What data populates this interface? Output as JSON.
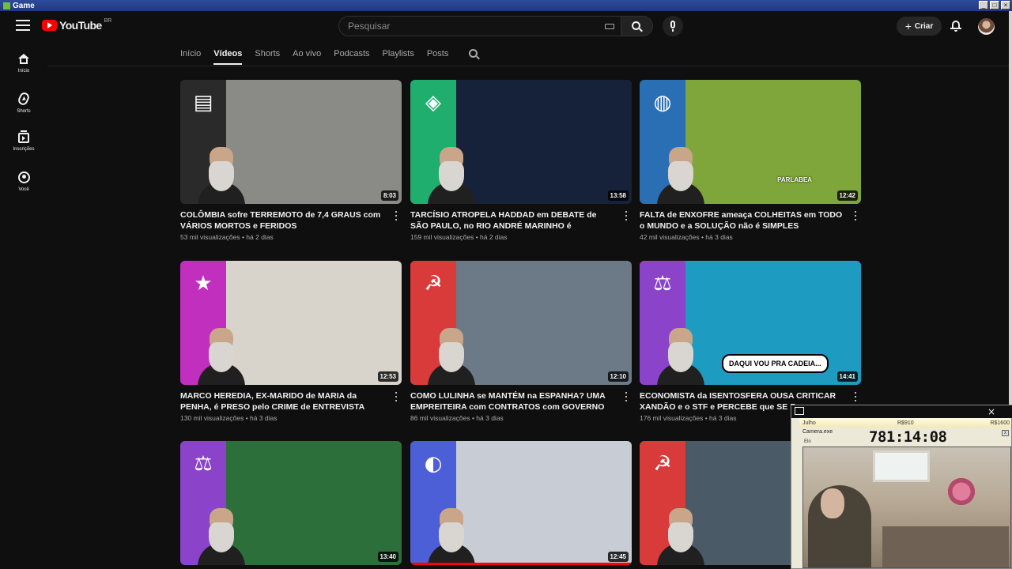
{
  "window": {
    "title": "Game",
    "buttons": [
      "_",
      "□",
      "×"
    ]
  },
  "header": {
    "logo_text": "YouTube",
    "logo_country": "BR",
    "search_placeholder": "Pesquisar",
    "create_label": "Criar",
    "create_icon": "+"
  },
  "sidebar": {
    "items": [
      {
        "label": "Início",
        "icon": "home-icon"
      },
      {
        "label": "Shorts",
        "icon": "shorts-icon"
      },
      {
        "label": "Inscrições",
        "icon": "subscriptions-icon"
      },
      {
        "label": "Você",
        "icon": "you-icon"
      }
    ]
  },
  "tabs": [
    {
      "label": "Início",
      "active": false
    },
    {
      "label": "Vídeos",
      "active": true
    },
    {
      "label": "Shorts",
      "active": false
    },
    {
      "label": "Ao vivo",
      "active": false
    },
    {
      "label": "Podcasts",
      "active": false
    },
    {
      "label": "Playlists",
      "active": false
    },
    {
      "label": "Posts",
      "active": false
    }
  ],
  "videos": [
    {
      "title": "COLÔMBIA sofre TERREMOTO de 7,4 GRAUS com VÁRIOS MORTOS e FERIDOS",
      "views": "53 mil visualizações",
      "age": "há 2 dias",
      "duration": "8:03",
      "band_color": "#2a2a2a",
      "badge": "newspaper-icon",
      "scene": "#8a8a86"
    },
    {
      "title": "TARCÍSIO ATROPELA HADDAD em DEBATE de SÃO PAULO, no RIO ANDRÉ MARINHO é DESTAQUE",
      "views": "159 mil visualizações",
      "age": "há 2 dias",
      "duration": "13:58",
      "band_color": "#1fae6e",
      "badge": "flag-brazil-icon",
      "scene": "#16213a"
    },
    {
      "title": "FALTA de ENXOFRE ameaça COLHEITAS em TODO o MUNDO e a SOLUÇÃO não é SIMPLES",
      "views": "42 mil visualizações",
      "age": "há 3 dias",
      "duration": "12:42",
      "band_color": "#2a6fb3",
      "badge": "globe-icon",
      "scene": "#7ea63a",
      "brand": "PARLABEA"
    },
    {
      "title": "MARCO HEREDIA, EX-MARIDO de MARIA da PENHA, é PRESO pelo CRIME de ENTREVISTA",
      "views": "130 mil visualizações",
      "age": "há 3 dias",
      "duration": "12:53",
      "band_color": "#c12fbf",
      "badge": "star-icon",
      "scene": "#d8d4cc"
    },
    {
      "title": "COMO LULINHA se MANTÉM na ESPANHA? UMA EMPREITEIRA com CONTRATOS com GOVERNO está ...",
      "views": "86 mil visualizações",
      "age": "há 3 dias",
      "duration": "12:10",
      "band_color": "#d93a3a",
      "badge": "hammer-sickle-icon",
      "scene": "#6b7a86"
    },
    {
      "title": "ECONOMISTA da ISENTOSFERA OUSA CRITICAR XANDÃO e o STF e PERCEBE que SE F...",
      "views": "176 mil visualizações",
      "age": "há 3 dias",
      "duration": "14:41",
      "band_color": "#8a43c9",
      "badge": "scales-icon",
      "scene": "#1e9bc0",
      "overlay": "DAQUI VOU PRA CADEIA..."
    },
    {
      "title": "",
      "views": "",
      "age": "",
      "duration": "13:40",
      "band_color": "#8a43c9",
      "badge": "scales-icon",
      "scene": "#2d6f3b"
    },
    {
      "title": "",
      "views": "",
      "age": "",
      "duration": "12:45",
      "band_color": "#4d5fd6",
      "badge": "phone-icon",
      "scene": "#c8ccd4",
      "progress": 1.0
    },
    {
      "title": "",
      "views": "",
      "age": "",
      "duration": "",
      "band_color": "#d93a3a",
      "badge": "hammer-sickle-icon",
      "scene": "#4a5a66"
    }
  ],
  "overlay": {
    "bar_left": "Julho",
    "bar_mid": "R$910",
    "bar_right": "R$1600",
    "camera_title": "Camera.exe",
    "name_label": "Elo",
    "clock": "781:14:08",
    "close_icon": "×"
  }
}
